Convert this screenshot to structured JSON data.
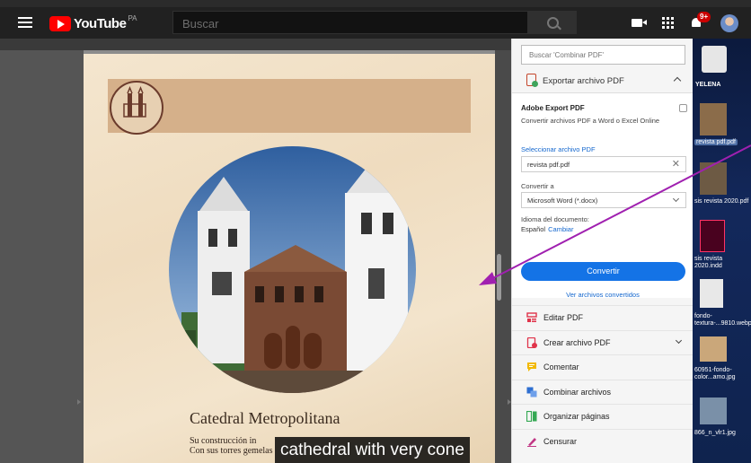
{
  "youtube": {
    "brand": "YouTube",
    "country": "PA",
    "search_placeholder": "Buscar",
    "notif_count": "9+",
    "colors": {
      "accent": "#ff0000",
      "bar_bg": "#212121"
    }
  },
  "document": {
    "title": "Catedral Metropolitana",
    "body_line1": "Su construcción in",
    "body_line2": "Con sus torres gemelas",
    "caption": "cathedral with very cone"
  },
  "panel": {
    "search_placeholder": "Buscar 'Combinar PDF'",
    "header": "Exportar archivo PDF",
    "card_title": "Adobe Export PDF",
    "card_subtitle": "Convertir archivos PDF a Word o Excel Online",
    "select_pdf_link": "Seleccionar archivo PDF",
    "file_name": "revista pdf.pdf",
    "convert_to_label": "Convertir a",
    "format": "Microsoft Word (*.docx)",
    "lang_label": "Idioma del documento:",
    "lang_value": "Español",
    "lang_change": "Cambiar",
    "convert_button": "Convertir",
    "view_converted": "Ver archivos convertidos",
    "tools": [
      {
        "label": "Editar PDF",
        "icon": "edit-pdf-icon",
        "color": "#e0334a"
      },
      {
        "label": "Crear archivo PDF",
        "icon": "create-pdf-icon",
        "color": "#e0334a"
      },
      {
        "label": "Comentar",
        "icon": "comment-icon",
        "color": "#f2b900"
      },
      {
        "label": "Combinar archivos",
        "icon": "combine-icon",
        "color": "#2e6fd1"
      },
      {
        "label": "Organizar páginas",
        "icon": "organize-icon",
        "color": "#34a853"
      },
      {
        "label": "Censurar",
        "icon": "redact-icon",
        "color": "#c13584"
      }
    ]
  },
  "desktop": {
    "items": [
      {
        "label": "YELENA"
      },
      {
        "label": "revista pdf.pdf"
      },
      {
        "label": "sis revista 2020.pdf"
      },
      {
        "label": "sis revista 2020.indd"
      },
      {
        "label": "fondo-textura-...9810.webp"
      },
      {
        "label": "60951-fondo-color...amo.jpg"
      },
      {
        "label": "866_n_vlr1.jpg"
      }
    ]
  }
}
